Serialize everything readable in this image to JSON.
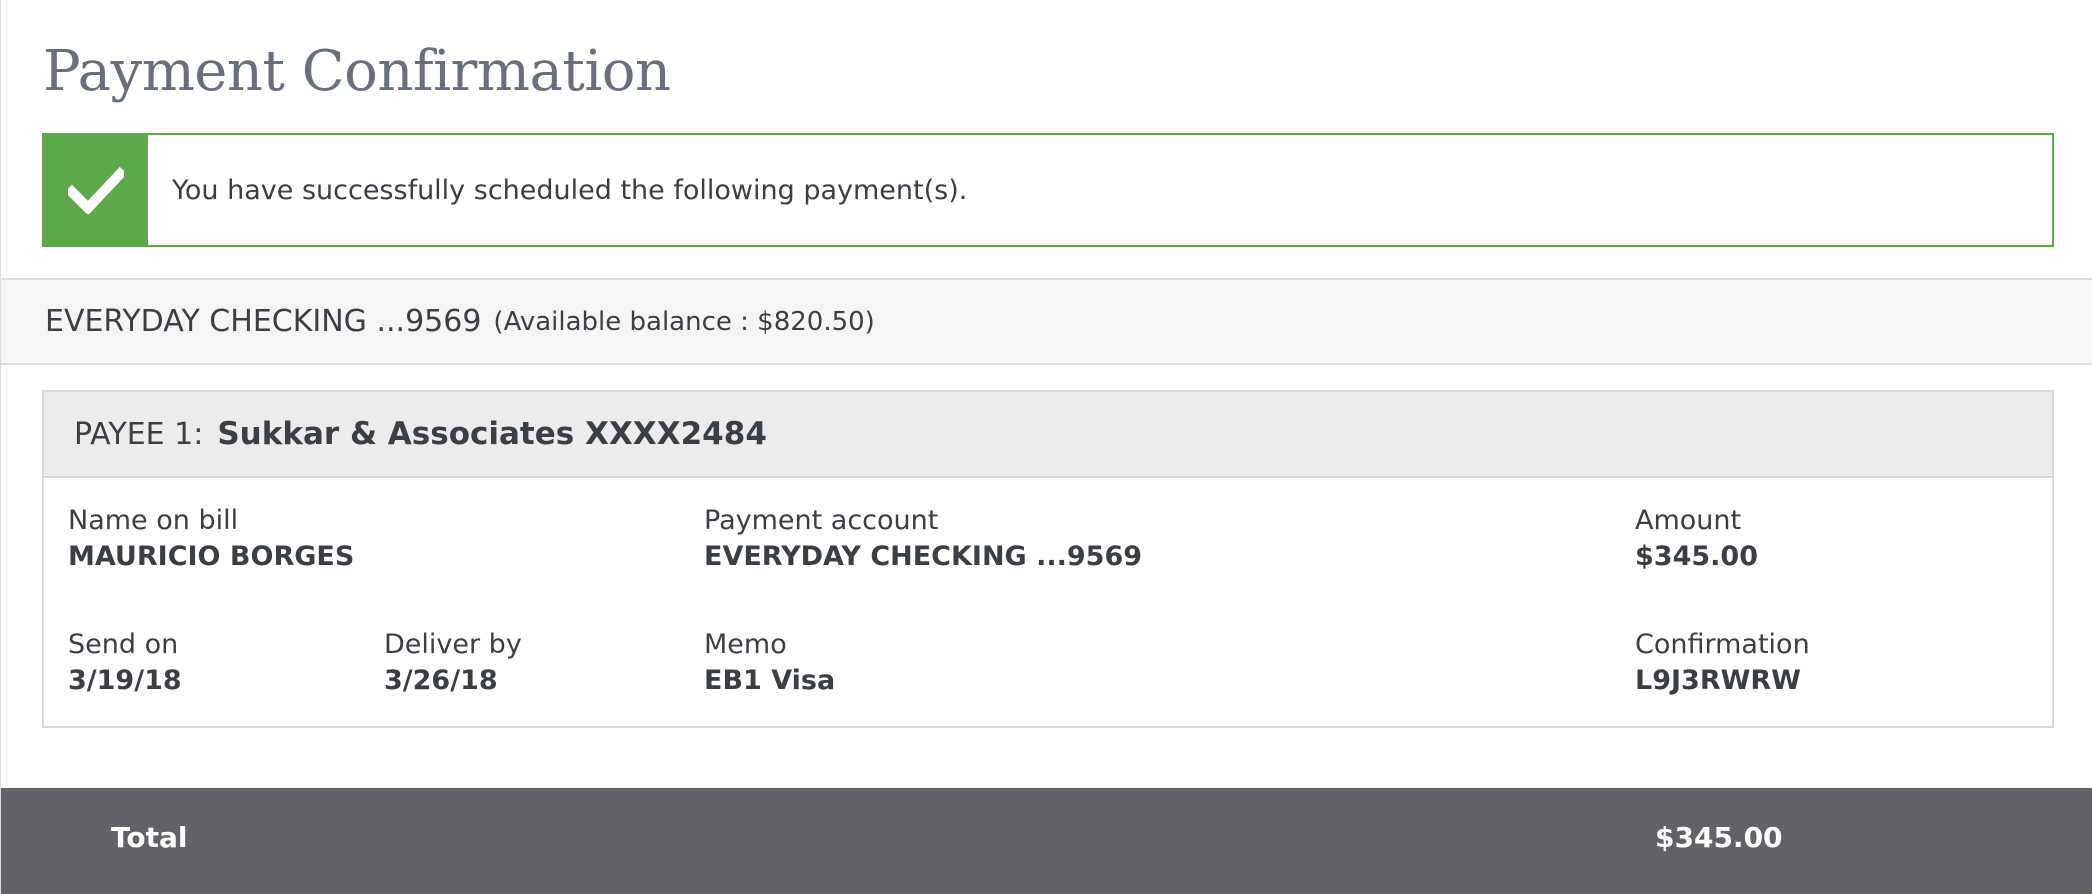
{
  "page": {
    "title": "Payment Confirmation"
  },
  "banner": {
    "message": "You have successfully scheduled the following payment(s).",
    "icon": "checkmark-icon",
    "color": "#5fa84b"
  },
  "account": {
    "name": "EVERYDAY CHECKING ...9569",
    "balance": "(Available balance : $820.50)"
  },
  "payees": [
    {
      "prefix": "PAYEE 1:",
      "name": "Sukkar & Associates XXXX2484",
      "fields": {
        "name_on_bill": {
          "label": "Name on bill",
          "value": "MAURICIO BORGES"
        },
        "payment_account": {
          "label": "Payment account",
          "value": "EVERYDAY CHECKING ...9569"
        },
        "amount": {
          "label": "Amount",
          "value": "$345.00"
        },
        "send_on": {
          "label": "Send on",
          "value": "3/19/18"
        },
        "deliver_by": {
          "label": "Deliver by",
          "value": "3/26/18"
        },
        "memo": {
          "label": "Memo",
          "value": "EB1 Visa"
        },
        "confirmation": {
          "label": "Confirmation",
          "value": "L9J3RWRW"
        }
      }
    }
  ],
  "total": {
    "label": "Total",
    "amount": "$345.00",
    "bar_color": "#616366"
  }
}
